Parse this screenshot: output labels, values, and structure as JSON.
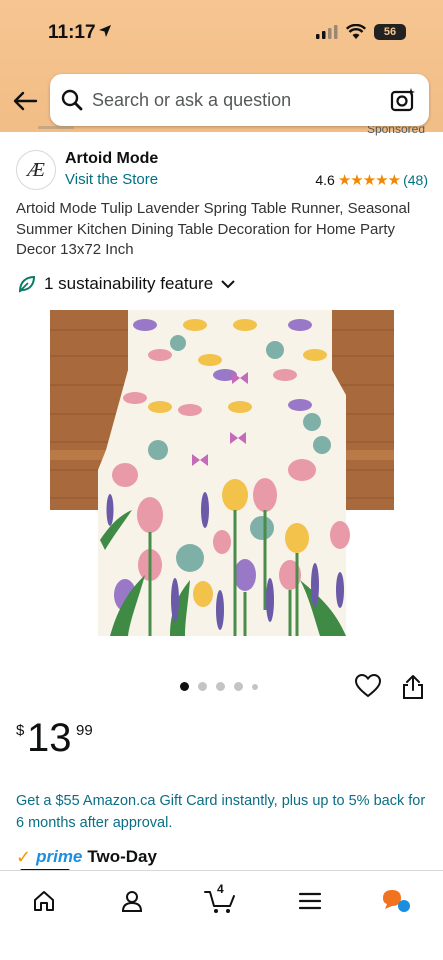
{
  "status": {
    "time": "11:17",
    "battery": "56"
  },
  "search": {
    "placeholder": "Search or ask a question"
  },
  "peek": {
    "sponsored": "Sponsored"
  },
  "brand": {
    "logo_text": "Æ",
    "name": "Artoid Mode",
    "visit": "Visit the Store",
    "rating": "4.6",
    "stars": "★★★★★",
    "review_count": "(48)"
  },
  "product": {
    "title": "Artoid Mode Tulip Lavender Spring Table Runner, Seasonal Summer Kitchen Dining Table Decoration for Home Party Decor 13x72 Inch",
    "sustainability": "1 sustainability feature",
    "image_count": 5,
    "active_image": 1
  },
  "price": {
    "currency": "$",
    "whole": "13",
    "fraction": "99"
  },
  "promo": {
    "text": "Get a $55 Amazon.ca Gift Card instantly, plus up to 5% back for 6 months after approval."
  },
  "prime": {
    "check": "✓",
    "label": "prime",
    "delivery": "Two-Day"
  },
  "nav": {
    "items": [
      "home-icon",
      "account-icon",
      "cart-icon",
      "menu-icon",
      "rufus-icon"
    ],
    "cart_count": "4"
  },
  "colors": {
    "header": "#f6c591",
    "link": "#007185",
    "star": "#f08804",
    "prime_blue": "#1d8fe0",
    "prime_check": "#f79400",
    "promo": "#0a6e85"
  }
}
